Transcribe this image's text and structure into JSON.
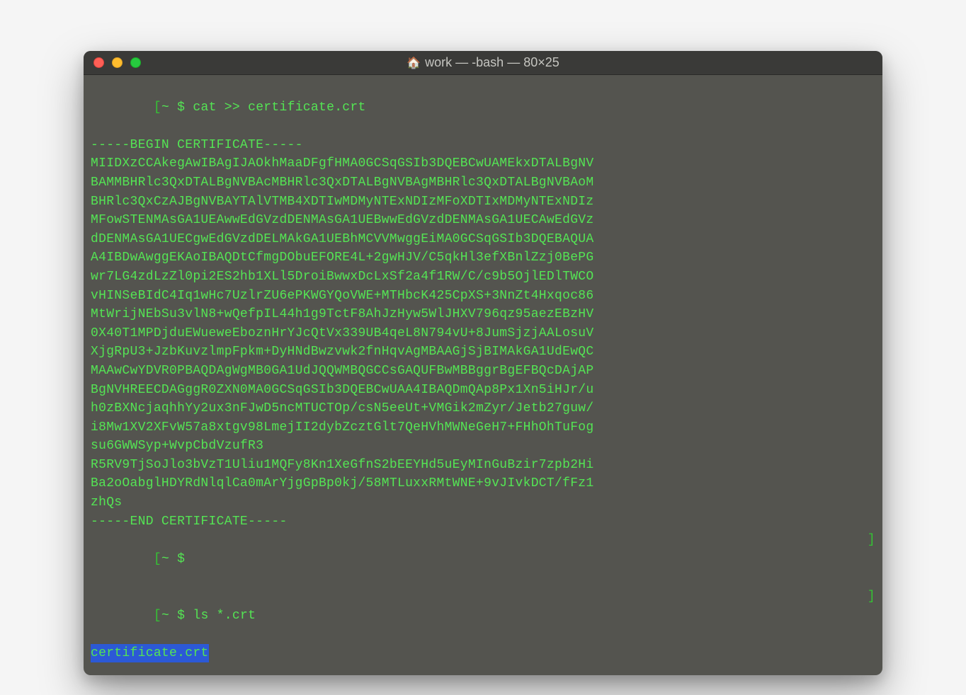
{
  "window": {
    "title": "work — -bash — 80×25",
    "icon": "🏠"
  },
  "colors": {
    "terminal_bg": "#54544f",
    "text_green": "#54e454",
    "highlight_bg": "#2c59d6"
  },
  "prompts": {
    "line1": {
      "open_bracket": "[",
      "path": "~ ",
      "symbol": "$ ",
      "command": "cat >> certificate.crt"
    },
    "line_empty": {
      "open_bracket": "[",
      "path": "~ ",
      "symbol": "$ ",
      "command": "",
      "close_bracket": "]"
    },
    "line_ls": {
      "open_bracket": "[",
      "path": "~ ",
      "symbol": "$ ",
      "command": "ls *.crt",
      "close_bracket": "]"
    }
  },
  "certificate": {
    "begin": "-----BEGIN CERTIFICATE-----",
    "lines": [
      "MIIDXzCCAkegAwIBAgIJAOkhMaaDFgfHMA0GCSqGSIb3DQEBCwUAMEkxDTALBgNV",
      "BAMMBHRlc3QxDTALBgNVBAcMBHRlc3QxDTALBgNVBAgMBHRlc3QxDTALBgNVBAoM",
      "BHRlc3QxCzAJBgNVBAYTAlVTMB4XDTIwMDMyNTExNDIzMFoXDTIxMDMyNTExNDIz",
      "MFowSTENMAsGA1UEAwwEdGVzdDENMAsGA1UEBwwEdGVzdDENMAsGA1UECAwEdGVz",
      "dDENMAsGA1UECgwEdGVzdDELMAkGA1UEBhMCVVMwggEiMA0GCSqGSIb3DQEBAQUA",
      "A4IBDwAwggEKAoIBAQDtCfmgDObuEFORE4L+2gwHJV/C5qkHl3efXBnlZzj0BePG",
      "wr7LG4zdLzZl0pi2ES2hb1XLl5DroiBwwxDcLxSf2a4f1RW/C/c9b5OjlEDlTWCO",
      "vHINSeBIdC4Iq1wHc7UzlrZU6ePKWGYQoVWE+MTHbcK425CpXS+3NnZt4Hxqoc86",
      "MtWrijNEbSu3vlN8+wQefpIL44h1g9TctF8AhJzHyw5WlJHXV796qz95aezEBzHV",
      "0X40T1MPDjduEWueweEboznHrYJcQtVx339UB4qeL8N794vU+8JumSjzjAALosuV",
      "XjgRpU3+JzbKuvzlmpFpkm+DyHNdBwzvwk2fnHqvAgMBAAGjSjBIMAkGA1UdEwQC",
      "MAAwCwYDVR0PBAQDAgWgMB0GA1UdJQQWMBQGCCsGAQUFBwMBBggrBgEFBQcDAjAP",
      "BgNVHREECDAGggR0ZXN0MA0GCSqGSIb3DQEBCwUAA4IBAQDmQAp8Px1Xn5iHJr/u",
      "h0zBXNcjaqhhYy2ux3nFJwD5ncMTUCTOp/csN5eeUt+VMGik2mZyr/Jetb27guw/",
      "i8Mw1XV2XFvW57a8xtgv98LmejII2dybZcztGlt7QeHVhMWNeGeH7+FHhOhTuFog",
      "su6GWWSyp+WvpCbdVzufR3",
      "R5RV9TjSoJlo3bVzT1Uliu1MQFy8Kn1XeGfnS2bEEYHd5uEyMInGuBzir7zpb2Hi",
      "Ba2oOabglHDYRdNlqlCa0mArYjgGpBp0kj/58MTLuxxRMtWNE+9vJIvkDCT/fFz1",
      "zhQs"
    ],
    "end": "-----END CERTIFICATE-----"
  },
  "output": {
    "ls_result": "certificate.crt"
  },
  "close_bracket_right": "]"
}
